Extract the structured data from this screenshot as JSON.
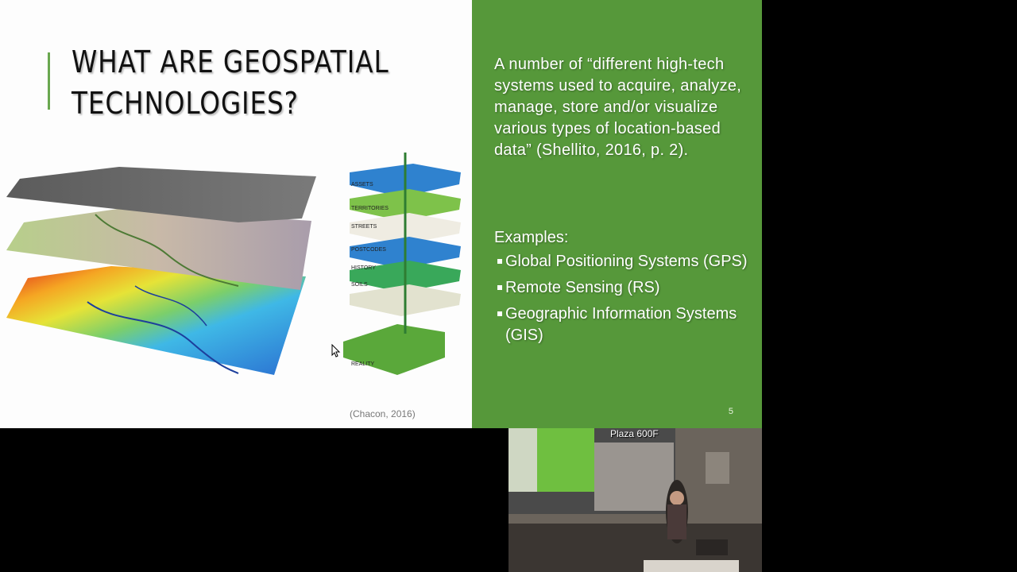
{
  "slide": {
    "title": "WHAT ARE GEOSPATIAL TECHNOLOGIES?",
    "definition": "A number of “different high-tech systems used to acquire, analyze, manage, store and/or visualize various types of location-based data” (Shellito, 2016, p. 2).",
    "examples_heading": "Examples:",
    "examples": [
      "Global Positioning Systems (GPS)",
      "Remote Sensing (RS)",
      "Geographic Information Systems (GIS)"
    ],
    "citation": "(Chacon, 2016)",
    "slide_number": "5",
    "layer_labels": [
      "ASSETS",
      "TERRITORIES",
      "STREETS",
      "POSTCODES",
      "HISTORY",
      "SOILS",
      "REALITY"
    ],
    "accent_color": "#56983a"
  },
  "webcam": {
    "room_label": "Plaza 600F"
  }
}
